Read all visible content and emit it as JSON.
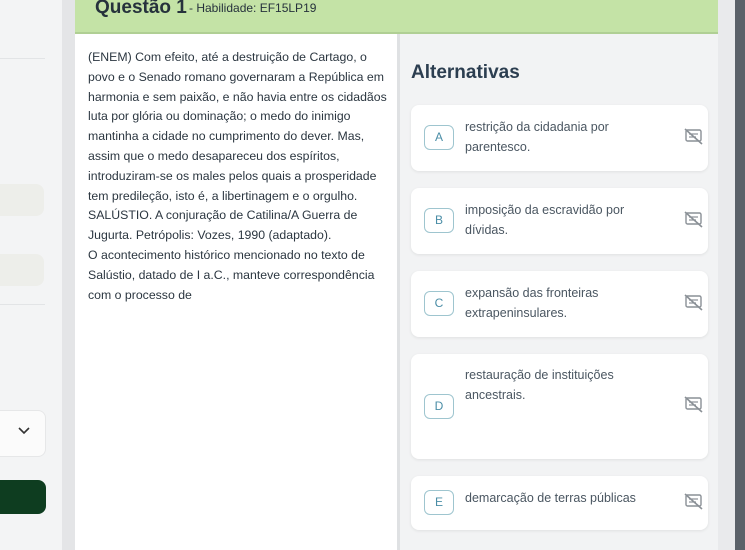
{
  "header": {
    "title": "Questão 1",
    "skill": "- Habilidade: EF15LP19"
  },
  "text": {
    "paragraph_1": "(ENEM) Com efeito, até a destruição de Cartago, o povo e o Senado romano governaram a República em harmonia e sem paixão, e não havia entre os cidadãos luta por glória ou dominação; o medo do inimigo mantinha a cidade no cumprimento do dever. Mas, assim que o medo desapareceu dos espíritos, introduziram-se os males pelos quais a prosperidade tem predileção, isto é, a libertinagem e o orgulho.",
    "source": "SALÚSTIO. A conjuração de Catilina/A Guerra de Jugurta. Petrópolis: Vozes, 1990 (adaptado).",
    "question": "O acontecimento histórico mencionado no texto de Salústio, datado de I a.C., manteve correspondência com o processo de"
  },
  "alternatives_title": "Alternativas",
  "alternatives": [
    {
      "letter": "A",
      "text": "restrição da cidadania por parentesco.",
      "icon": "eye-off-icon"
    },
    {
      "letter": "B",
      "text": "imposição da escravidão por dívidas.",
      "icon": "eye-off-icon"
    },
    {
      "letter": "C",
      "text": "expansão das fronteiras extrapeninsulares.",
      "icon": "eye-off-icon"
    },
    {
      "letter": "D",
      "text": "restauração de instituições ancestrais.",
      "icon": "eye-off-icon"
    },
    {
      "letter": "E",
      "text": "demarcação de terras públicas",
      "icon": "eye-off-icon"
    }
  ],
  "sidebar": {
    "select_icon": "chevron-down-icon"
  },
  "colors": {
    "header_bg": "#c4e3a6",
    "letter_border": "#9ec5cf",
    "sidebar_button": "#0e3d20"
  }
}
